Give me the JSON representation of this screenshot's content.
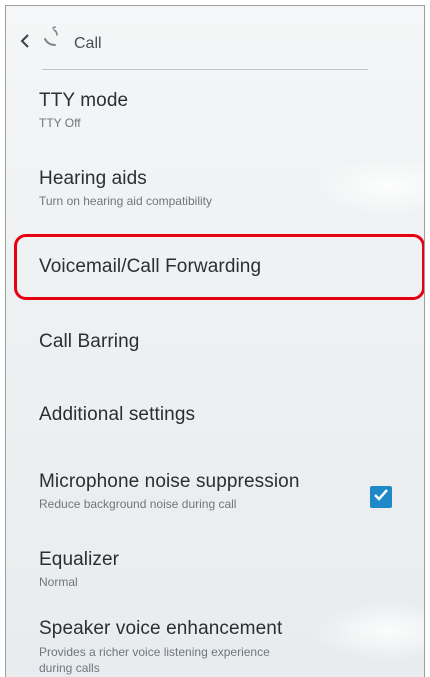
{
  "header": {
    "title": "Call"
  },
  "items": [
    {
      "title": "TTY mode",
      "summary": "TTY Off"
    },
    {
      "title": "Hearing aids",
      "summary": "Turn on hearing aid compatibility"
    },
    {
      "title": "Voicemail/Call Forwarding",
      "summary": ""
    },
    {
      "title": "Call Barring",
      "summary": ""
    },
    {
      "title": "Additional settings",
      "summary": ""
    },
    {
      "title": "Microphone noise suppression",
      "summary": "Reduce background noise during call",
      "checked": true
    },
    {
      "title": "Equalizer",
      "summary": "Normal"
    },
    {
      "title": "Speaker voice enhancement",
      "summary": "Provides a richer voice listening experience during calls"
    }
  ],
  "colors": {
    "highlight": "#e50012",
    "checkbox": "#1e88c9",
    "text": "#2b2f33"
  },
  "icons": {
    "back": "chevron-left-icon",
    "app": "phone-icon",
    "check": "check-icon"
  }
}
